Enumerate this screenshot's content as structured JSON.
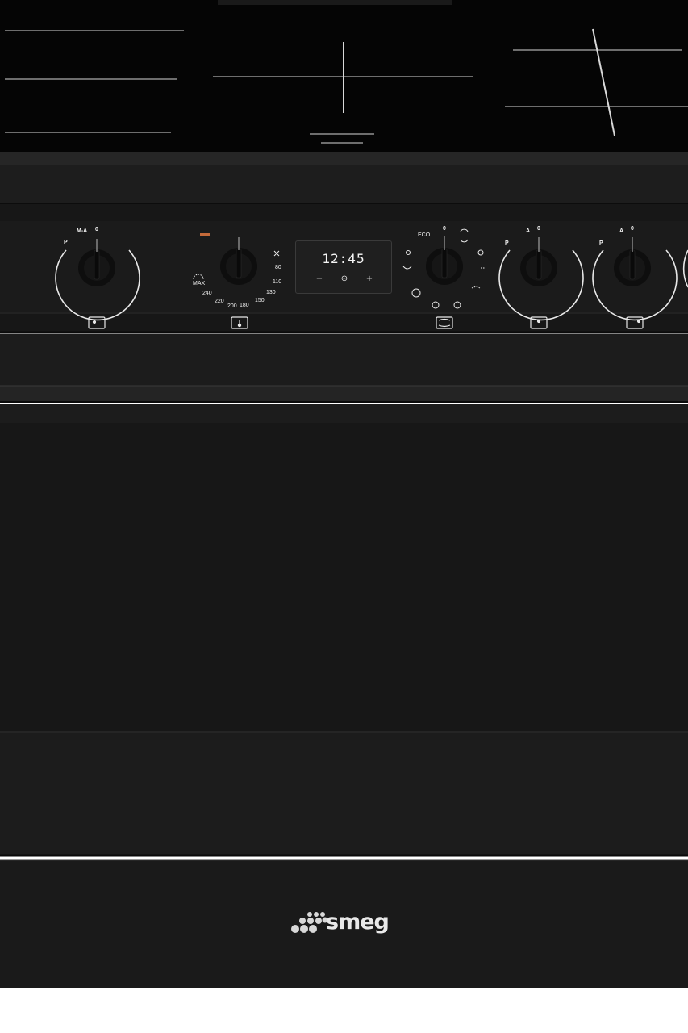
{
  "appliance": {
    "brand_logo": "smeg",
    "colors": {
      "body": "#1c1c1c",
      "cooktop": "#050505",
      "panel": "#161616",
      "markings": "#f2f2f2",
      "indicator": "#c46a3a"
    }
  },
  "control_panel": {
    "knob_1": {
      "label_top": "M-A",
      "zero": "0",
      "label_side": "P",
      "icon": "single-zone-icon"
    },
    "thermostat_knob": {
      "scale": [
        "MAX",
        "240",
        "220",
        "200",
        "180",
        "150",
        "130",
        "110",
        "80"
      ],
      "icon": "thermometer-icon"
    },
    "clock": {
      "time": "12:45",
      "minus": "−",
      "clock_icon": "⊝",
      "plus": "+"
    },
    "function_knob": {
      "label_eco": "ECO",
      "zero": "0",
      "icon": "oven-cavity-icon"
    },
    "knob_4": {
      "label_top": "A",
      "zero": "0",
      "label_side": "P",
      "icon": "rear-zone-icon"
    },
    "knob_5": {
      "label_top": "A",
      "zero": "0",
      "label_side": "P",
      "icon": "rear-right-zone-icon"
    }
  }
}
